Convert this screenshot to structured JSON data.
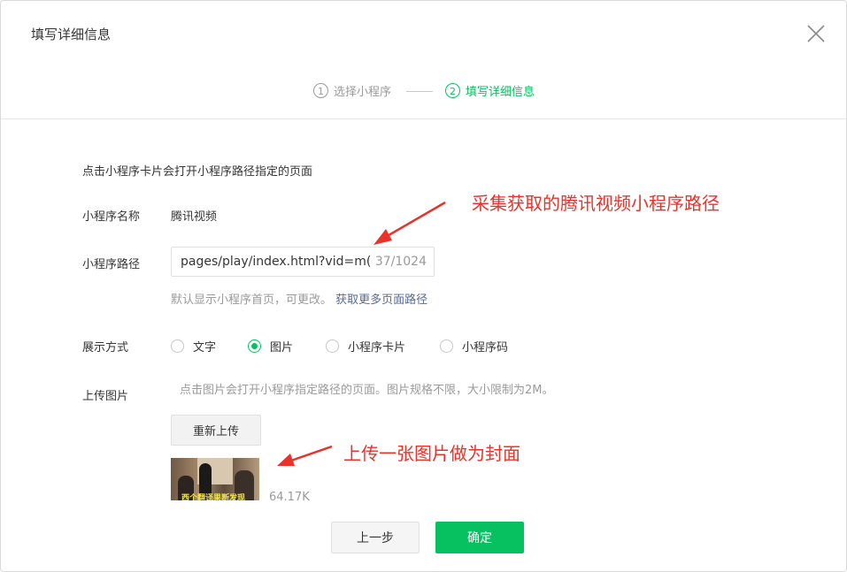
{
  "dialog": {
    "title": "填写详细信息"
  },
  "steps": [
    {
      "num": "1",
      "label": "选择小程序",
      "active": false
    },
    {
      "num": "2",
      "label": "填写详细信息",
      "active": true
    }
  ],
  "form": {
    "description": "点击小程序卡片会打开小程序路径指定的页面",
    "name_label": "小程序名称",
    "name_value": "腾讯视频",
    "path_label": "小程序路径",
    "path_value": "pages/play/index.html?vid=m(",
    "path_counter": "37/1024",
    "hint_text": "默认显示小程序首页，可更改。",
    "hint_link": "获取更多页面路径",
    "display_label": "展示方式",
    "display_options": [
      {
        "label": "文字",
        "checked": false
      },
      {
        "label": "图片",
        "checked": true
      },
      {
        "label": "小程序卡片",
        "checked": false
      },
      {
        "label": "小程序码",
        "checked": false
      }
    ],
    "upload_label": "上传图片",
    "upload_hint": "点击图片会打开小程序指定路径的页面。图片规格不限，大小限制为2M。",
    "reupload_label": "重新上传",
    "thumbnail_caption": "西个翻译果断发现",
    "file_size": "64.17K"
  },
  "footer": {
    "prev_label": "上一步",
    "ok_label": "确定"
  },
  "annotations": {
    "path_note": "采集获取的腾讯视频小程序路径",
    "cover_note": "上传一张图片做为封面"
  },
  "colors": {
    "accent": "#07c160",
    "link": "#576b95",
    "annotation": "#e8332a"
  }
}
